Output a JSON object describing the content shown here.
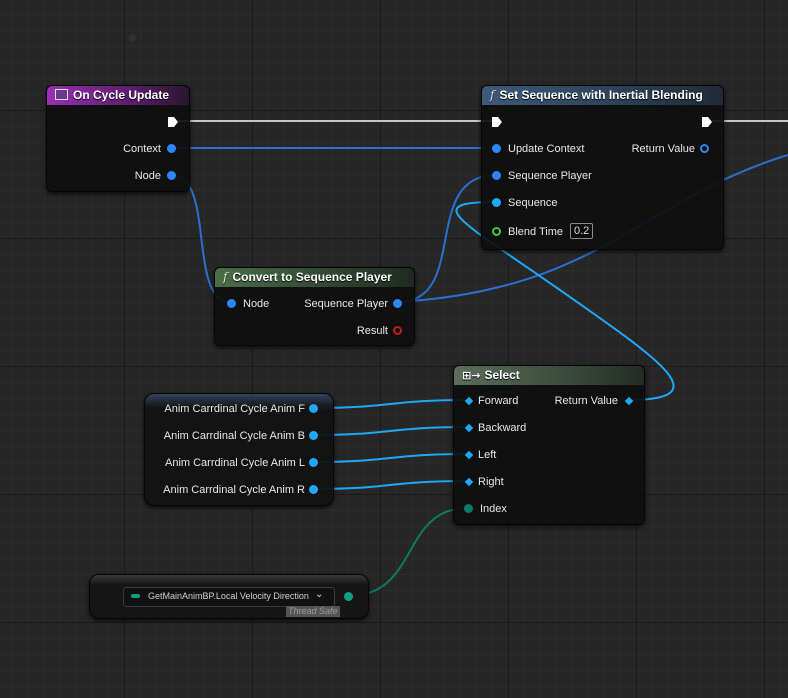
{
  "nodes": {
    "on_cycle_update": {
      "title": "On Cycle Update",
      "pins": {
        "context": "Context",
        "node": "Node"
      }
    },
    "set_sequence": {
      "title": "Set Sequence with Inertial Blending",
      "pins": {
        "update_context": "Update Context",
        "sequence_player": "Sequence Player",
        "sequence": "Sequence",
        "blend_time": "Blend Time",
        "return_value": "Return Value"
      },
      "blend_time_value": "0.2"
    },
    "convert": {
      "title": "Convert to Sequence Player",
      "pins": {
        "node": "Node",
        "sequence_player": "Sequence Player",
        "result": "Result"
      }
    },
    "select": {
      "title": "Select",
      "pins": {
        "forward": "Forward",
        "backward": "Backward",
        "left": "Left",
        "right": "Right",
        "index": "Index",
        "return_value": "Return Value"
      }
    },
    "anim_vars": {
      "items": [
        "Anim Carrdinal Cycle Anim F",
        "Anim Carrdinal Cycle Anim B",
        "Anim Carrdinal Cycle Anim L",
        "Anim Carrdinal Cycle Anim R"
      ]
    },
    "getter": {
      "value": "GetMainAnimBP.Local Velocity Direction",
      "badge": "Thread Safe"
    }
  },
  "colors": {
    "background": "#262626",
    "event_header": "#8a2aa0",
    "function_header": "#3a4f6a",
    "pure_function_header": "#3c5a3a",
    "select_header": "#4a5a4a",
    "object_pin": "#2c87f5",
    "struct_pin": "#1ea8f5",
    "enum_pin": "#10a080",
    "exec_wire": "#ffffff"
  }
}
